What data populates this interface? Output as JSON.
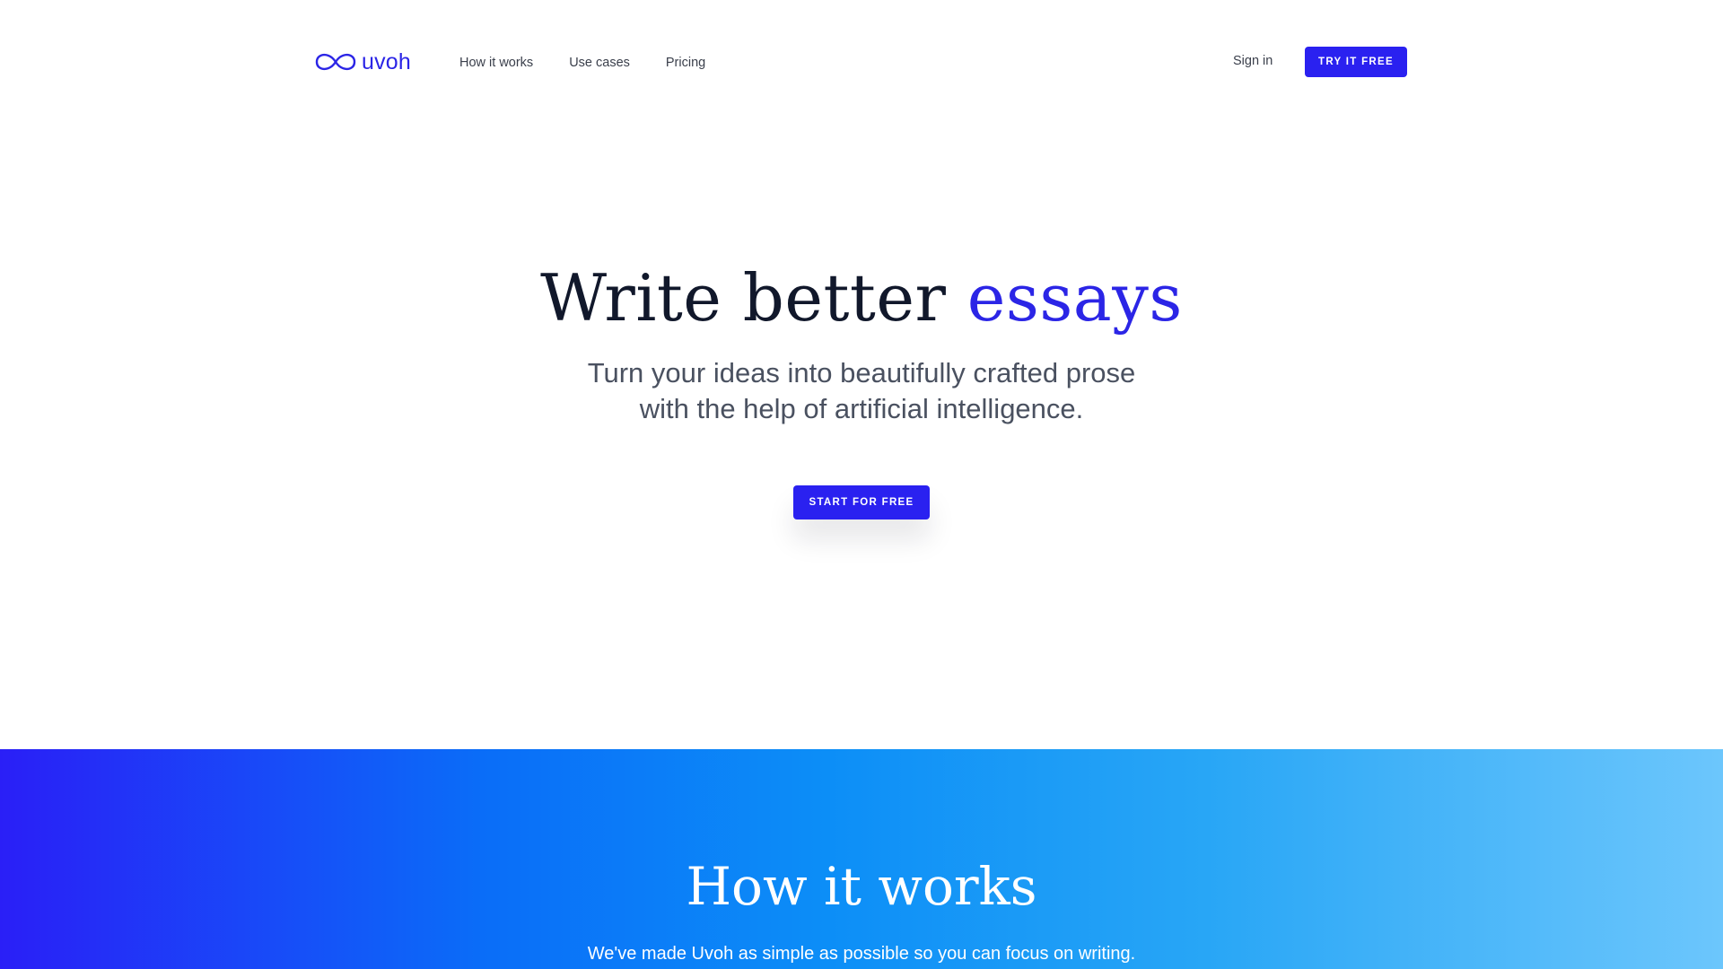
{
  "header": {
    "logo_text": "uvoh",
    "nav": [
      {
        "label": "How it works"
      },
      {
        "label": "Use cases"
      },
      {
        "label": "Pricing"
      }
    ],
    "signin_label": "Sign in",
    "cta_label": "TRY IT FREE"
  },
  "hero": {
    "title_main": "Write better ",
    "title_accent": "essays",
    "subtitle_line1": "Turn your ideas into beautifully crafted prose",
    "subtitle_line2": "with the help of artificial intelligence.",
    "cta_label": "START FOR FREE"
  },
  "how_it_works": {
    "title": "How it works",
    "subtitle": "We've made Uvoh as simple as possible so you can focus on writing."
  },
  "colors": {
    "brand": "#2b25e6",
    "button": "#2a21f0",
    "heading": "#11182b",
    "body_text": "#4a5160",
    "gradient_start": "#2a1ff7",
    "gradient_end": "#6cc6fc"
  },
  "icons": {
    "logo": "infinity-icon"
  }
}
